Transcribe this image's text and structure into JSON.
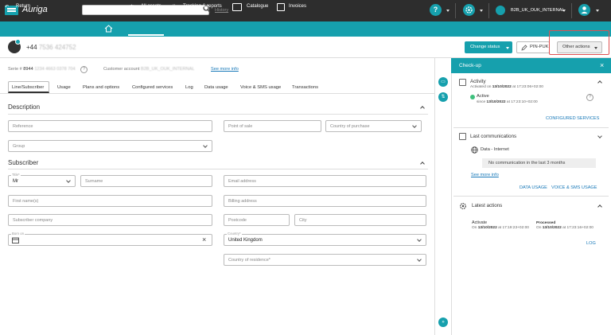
{
  "topbar": {
    "brand": "Auriga",
    "search_placeholder": "",
    "history_label": "History",
    "help_glyph": "?",
    "account_name": "B2B_UK_OUK_INTERNAL"
  },
  "nav": {
    "return_label": "Return",
    "home": "",
    "all_assets": "All assets",
    "tracking": "Tracking & reports",
    "catalogue": "Catalogue",
    "invoices": "Invoices"
  },
  "header": {
    "phone_prefix": "+44",
    "phone_rest": "7536 424752",
    "change_status": "Change status",
    "pin_puk": "PIN-PUK",
    "other_actions": "Other actions"
  },
  "serial": {
    "label": "Serie #",
    "value_prefix": "8944",
    "value_rest": "1234 4663 0378 704",
    "customer_label": "Customer account",
    "customer_value": "B2B_UK_OUK_INTERNAL",
    "see_more": "See more info"
  },
  "tabs": [
    "Line/Subscriber",
    "Usage",
    "Plans and options",
    "Configured services",
    "Log",
    "Data usage",
    "Voice & SMS usage",
    "Transactions"
  ],
  "description": {
    "title": "Description",
    "reference": "Reference",
    "point_of_sale": "Point of sale",
    "country_of_purchase": "Country of purchase",
    "group": "Group"
  },
  "subscriber": {
    "title": "Subscriber",
    "title_label": "Title*",
    "title_value": "Mr",
    "surname": "Surname",
    "email": "Email address",
    "first_names": "First name(s)",
    "billing": "Billing address",
    "company": "Subscriber company",
    "postcode": "Postcode",
    "city": "City",
    "born_on": "Born on",
    "country_label": "Country*",
    "country_value": "United Kingdom",
    "residence": "Country of residence*"
  },
  "checkup": {
    "title": "Check-up",
    "close": "×",
    "activity_title": "Activity",
    "activated_text": "Activated on",
    "activated_date": "13/10/2022",
    "activated_at": "at 17:23:06+02:00",
    "active_label": "Active",
    "active_since": "since",
    "active_date": "13/10/2022",
    "active_at": "at 17:23:10+02:00",
    "configured_services": "CONFIGURED SERVICES",
    "comm_title": "Last communications",
    "data_internet": "Data - Internet",
    "no_comm": "No communication in the last 3 months",
    "see_more": "See more info",
    "data_usage": "DATA USAGE",
    "voice_sms": "VOICE & SMS USAGE",
    "actions_title": "Latest actions",
    "action1": "Activate",
    "action1_on": "On",
    "action1_date": "13/10/2022",
    "action1_at": "at 17:19:23+02:00",
    "action2_status": "Processed",
    "action2_on": "On",
    "action2_date": "13/10/2022",
    "action2_at": "at 17:23:16+02:00",
    "log": "LOG"
  },
  "side_buttons": {
    "expand": "»"
  },
  "colors": {
    "accent": "#16a0ad",
    "topbar": "#2d2d2d",
    "active_green": "#3ec07d",
    "highlight": "#e05050"
  }
}
